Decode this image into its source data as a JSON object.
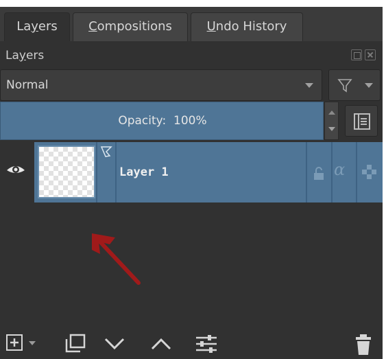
{
  "tabs": [
    {
      "pre": "La",
      "ul": "y",
      "post": "ers"
    },
    {
      "pre": "",
      "ul": "C",
      "post": "ompositions"
    },
    {
      "pre": "",
      "ul": "U",
      "post": "ndo History"
    }
  ],
  "docker": {
    "title_pre": "La",
    "title_ul": "y",
    "title_post": "ers"
  },
  "blend_mode": "Normal",
  "opacity": {
    "label": "Opacity:",
    "value": "100%"
  },
  "layer": {
    "name": "Layer 1",
    "alpha_symbol": "α"
  },
  "colors": {
    "panel": "#313131",
    "selection": "#4f7596",
    "annotation_arrow": "#a01a1a"
  },
  "icons": [
    "eye-icon",
    "lock-icon",
    "alpha-lock-icon",
    "inherit-alpha-icon",
    "filter-icon",
    "properties-icon",
    "add-layer-icon",
    "duplicate-icon",
    "move-down-icon",
    "move-up-icon",
    "layer-settings-icon",
    "delete-icon"
  ]
}
